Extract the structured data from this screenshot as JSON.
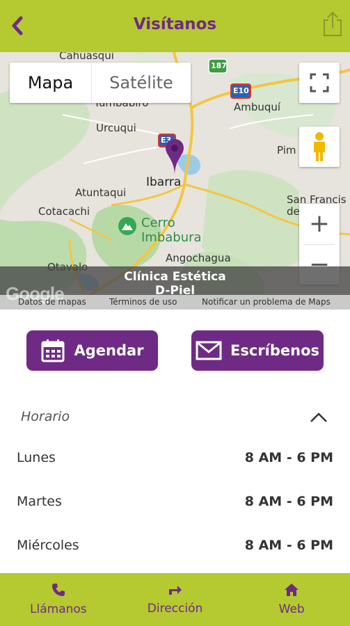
{
  "header": {
    "title": "Visítanos",
    "back_icon": "chevron-left-icon",
    "share_icon": "share-icon",
    "background": "#b5c931",
    "accent": "#6f2a85"
  },
  "map": {
    "type_map": "Mapa",
    "type_satellite": "Satélite",
    "labels": {
      "cahuasqui": "Cahuasqui",
      "tumbabiro": "Tumbabiro",
      "urcuqui": "Urcuqui",
      "ambuqui": "Ambuquí",
      "pim": "Pim",
      "atuntaqui": "Atuntaqui",
      "ibarra": "Ibarra",
      "cotacachi": "Cotacachi",
      "cerro": "Cerro",
      "imbabura": "Imbabura",
      "san_francisco": "San Francis",
      "de": "de",
      "angochagua": "Angochagua",
      "otavalo": "Otavalo"
    },
    "shields": {
      "r187": "187",
      "e10": "E10",
      "e35": "E3"
    },
    "place_name_line1": "Clínica Estética",
    "place_name_line2": "D-Piel",
    "google": "Google",
    "footer": {
      "map_data": "Datos de mapas",
      "terms": "Términos de uso",
      "report": "Notificar un problema de Maps"
    },
    "zoom_in": "+",
    "zoom_out": "−"
  },
  "actions": {
    "schedule_label": "Agendar",
    "write_label": "Escríbenos"
  },
  "schedule": {
    "title": "Horario",
    "rows": [
      {
        "day": "Lunes",
        "hours": "8 AM - 6 PM"
      },
      {
        "day": "Martes",
        "hours": "8 AM - 6 PM"
      },
      {
        "day": "Miércoles",
        "hours": "8 AM - 6 PM"
      }
    ]
  },
  "bottom_nav": {
    "call": "Llámanos",
    "directions": "Dirección",
    "web": "Web"
  }
}
